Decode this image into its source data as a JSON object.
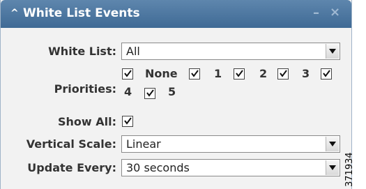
{
  "window": {
    "title": "White List Events",
    "collapse_icon": "caret-up-icon",
    "minimize_icon": "minimize-icon",
    "close_icon": "close-icon"
  },
  "form": {
    "white_list": {
      "label": "White List:",
      "value": "All"
    },
    "priorities": {
      "label": "Priorities:",
      "options": [
        {
          "label": "None",
          "checked": true
        },
        {
          "label": "1",
          "checked": true
        },
        {
          "label": "2",
          "checked": true
        },
        {
          "label": "3",
          "checked": true
        },
        {
          "label": "4",
          "checked": true
        },
        {
          "label": "5",
          "checked": true
        }
      ]
    },
    "show_all": {
      "label": "Show All:",
      "checked": true
    },
    "vertical_scale": {
      "label": "Vertical Scale:",
      "value": "Linear"
    },
    "update_every": {
      "label": "Update Every:",
      "value": "30 seconds"
    }
  },
  "figure_code": "371934",
  "colors": {
    "titlebar": "#4a75a0",
    "panel": "#f2f2f2"
  }
}
